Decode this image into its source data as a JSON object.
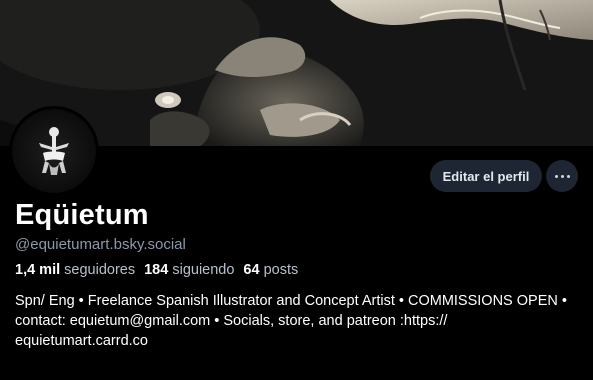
{
  "profile": {
    "display_name": "Eqüietum",
    "handle": "@equietumart.bsky.social",
    "stats": {
      "followers_count": "1,4 mil",
      "followers_label": "seguidores",
      "following_count": "184",
      "following_label": "siguiendo",
      "posts_count": "64",
      "posts_label": "posts"
    },
    "bio": "Spn/ Eng • Freelance Spanish Illustrator and Concept Artist • COMMISSIONS OPEN • contact: equietum@gmail.com • Socials, store, and patreon :https:// equietumart.carrd.co"
  },
  "actions": {
    "edit_profile_label": "Editar el perfil",
    "more_icon": "ellipsis-icon"
  },
  "colors": {
    "background": "#000000",
    "button_bg": "#1e2533",
    "handle_text": "#8c97a8",
    "secondary_text": "#b8c0cc"
  }
}
